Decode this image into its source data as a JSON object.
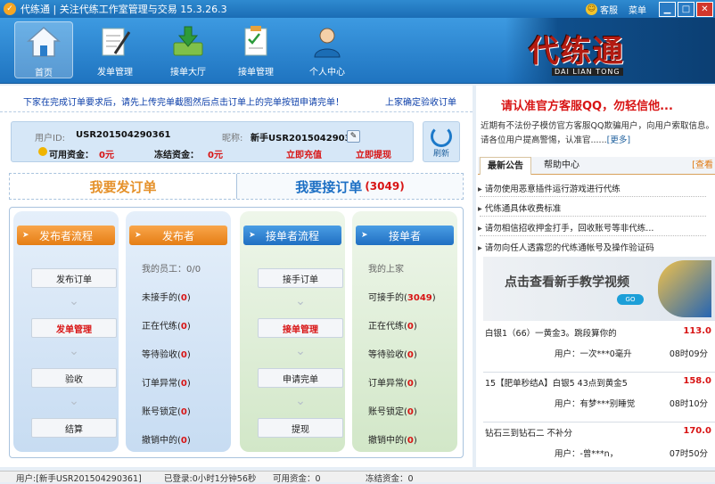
{
  "window": {
    "title": "代练通 | 关注代练工作室管理与交易 15.3.26.3",
    "customer_service": "客服",
    "menu": "菜单",
    "minimize": "▁",
    "maximize": "□",
    "close": "✕"
  },
  "nav": {
    "items": [
      {
        "label": "首页"
      },
      {
        "label": "发单管理"
      },
      {
        "label": "接单大厅"
      },
      {
        "label": "接单管理"
      },
      {
        "label": "个人中心"
      }
    ],
    "brand": "代练通",
    "brand_sub": "DAI LIAN TONG"
  },
  "notice": {
    "text": "下家在完成订单要求后，请先上传完单截图然后点击订单上的完单按钮申请完单！",
    "link": "上家确定验收订单"
  },
  "user": {
    "id_label": "用户ID:",
    "id_value": "USR201504290361",
    "nick_label": "昵称:",
    "nick_value": "新手USR2015042903",
    "available_label": "可用资金：",
    "available_value": "0元",
    "frozen_label": "冻结资金：",
    "frozen_value": "0元",
    "recharge": "立即充值",
    "withdraw": "立即提现",
    "refresh": "刷新"
  },
  "tabs": {
    "publish": "我要发订单",
    "accept": "我要接订单",
    "accept_count": "(3049)"
  },
  "publisher_flow": {
    "title": "发布者流程",
    "steps": [
      "发布订单",
      "发单管理",
      "验收",
      "结算"
    ]
  },
  "publisher": {
    "title": "发布者",
    "staff": "我的员工：0/0",
    "stats": [
      {
        "label": "未接手的",
        "value": "0"
      },
      {
        "label": "正在代练",
        "value": "0"
      },
      {
        "label": "等待验收",
        "value": "0"
      },
      {
        "label": "订单异常",
        "value": "0"
      },
      {
        "label": "账号锁定",
        "value": "0"
      },
      {
        "label": "撤销中的",
        "value": "0"
      }
    ]
  },
  "acceptor_flow": {
    "title": "接单者流程",
    "steps": [
      "接手订单",
      "接单管理",
      "申请完单",
      "提现"
    ]
  },
  "acceptor": {
    "title": "接单者",
    "upstream": "我的上家",
    "stats": [
      {
        "label": "可接手的",
        "value": "3049"
      },
      {
        "label": "正在代练",
        "value": "0"
      },
      {
        "label": "等待验收",
        "value": "0"
      },
      {
        "label": "订单异常",
        "value": "0"
      },
      {
        "label": "账号锁定",
        "value": "0"
      },
      {
        "label": "撤销中的",
        "value": "0"
      }
    ]
  },
  "right": {
    "warning_title": "请认准官方客服QQ，勿轻信他...",
    "warning_text": "近期有不法份子模仿官方客服QQ欺骗用户，向用户索取信息。请各位用户提高警惕，认准官......",
    "more": "[更多]",
    "tabs": [
      "最新公告",
      "帮助中心"
    ],
    "tab_more": "[查看",
    "news": [
      "请勿使用恶意插件运行游戏进行代练",
      "代练通具体收费标准",
      "请勿相信招收押金打手，回收账号等非代练...",
      "请勿向任人透露您的代练通帐号及操作验证码"
    ],
    "video_banner": "点击查看新手教学视频",
    "video_go": "GO",
    "orders": [
      {
        "title": "白银1（66）一黄金3。跳段算你的",
        "price": "113.0",
        "user": "用户：一次***0毫升",
        "time": "08时09分"
      },
      {
        "title": "15【肥单秒结A】白银5 43点到黄金5",
        "price": "158.0",
        "user": "用户：有梦***别睡觉",
        "time": "08时10分"
      },
      {
        "title": "钻石三到钻石二 不补分",
        "price": "170.0",
        "user": "用户：-曾***n，",
        "time": "07时50分"
      }
    ]
  },
  "statusbar": {
    "user": "用户:[新手USR201504290361]",
    "login": "已登录:0小时1分钟56秒",
    "available": "可用资金：0",
    "frozen": "冻结资金：0"
  }
}
